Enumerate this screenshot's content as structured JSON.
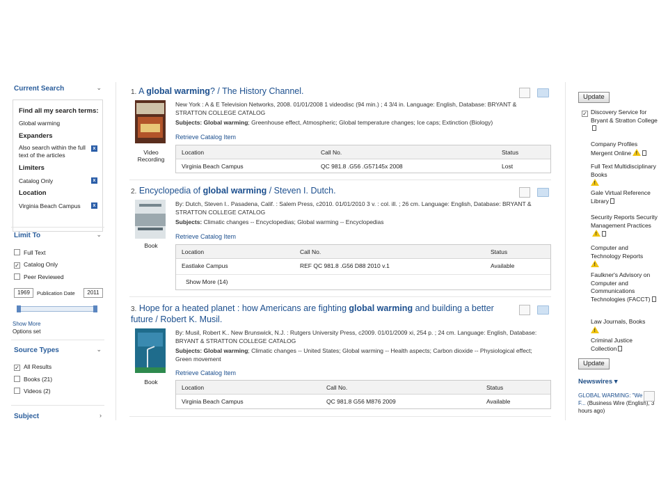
{
  "left": {
    "current_search": {
      "header": "Current Search",
      "find_all_label": "Find all my search terms:",
      "term": "Global warming",
      "expanders_label": "Expanders",
      "expander_item": "Also search within the full text of the articles",
      "limiters_label": "Limiters",
      "limiter_item": "Catalog Only",
      "location_label": "Location",
      "location_item": "Virginia Beach Campus"
    },
    "limit_to": {
      "header": "Limit To",
      "options": [
        {
          "label": "Full Text",
          "checked": false
        },
        {
          "label": "Catalog Only",
          "checked": true
        },
        {
          "label": "Peer Reviewed",
          "checked": false
        }
      ],
      "date_from": "1969",
      "date_label": "Publication Date",
      "date_to": "2011",
      "show_more": "Show More",
      "options_set": "Options set"
    },
    "source_types": {
      "header": "Source Types",
      "options": [
        {
          "label": "All Results",
          "checked": true
        },
        {
          "label": "Books (21)",
          "checked": false
        },
        {
          "label": "Videos (2)",
          "checked": false
        }
      ]
    },
    "subject_header": "Subject"
  },
  "results": [
    {
      "num": "1.",
      "title_pre": "A ",
      "title_bold": "global warming",
      "title_post": "? / The History Channel.",
      "title_line2": "",
      "type": "Video Recording",
      "meta": "New York : A & E Television Networks, 2008. 01/01/2008 1 videodisc (94 min.) ; 4 3/4 in. Language: English, Database: BRYANT & STRATTON COLLEGE CATALOG",
      "subjects_label": "Subjects:",
      "subjects_b1": "Global warming",
      "subjects_rest": "; Greenhouse effect, Atmospheric; Global temperature changes; Ice caps; Extinction (Biology)",
      "retrieve": "Retrieve Catalog Item",
      "holdings_headers": [
        "Location",
        "Call No.",
        "Status"
      ],
      "holdings": [
        "Virginia Beach Campus",
        "QC 981.8 .G56 .G57145x 2008",
        "Lost"
      ],
      "show_more": ""
    },
    {
      "num": "2.",
      "title_pre": "Encyclopedia of ",
      "title_bold": "global warming",
      "title_post": " / Steven I. Dutch.",
      "title_line2": "",
      "type": "Book",
      "meta": "By: Dutch, Steven I.. Pasadena, Calif. : Salem Press, c2010. 01/01/2010 3 v. : col. ill. ; 26 cm. Language: English, Database: BRYANT & STRATTON COLLEGE CATALOG",
      "subjects_label": "Subjects:",
      "subjects_b1": "",
      "subjects_rest": "Climatic changes -- Encyclopedias; Global warming -- Encyclopedias",
      "retrieve": "Retrieve Catalog Item",
      "holdings_headers": [
        "Location",
        "Call No.",
        "Status"
      ],
      "holdings": [
        "Eastlake Campus",
        "REF QC 981.8 .G56 D88 2010 v.1",
        "Available"
      ],
      "show_more": "Show More (14)"
    },
    {
      "num": "3.",
      "title_pre": "Hope for a heated planet : how Americans are fighting ",
      "title_bold": "global warming",
      "title_post": " and building a better",
      "title_line2": "future / Robert K. Musil.",
      "type": "Book",
      "meta": "By: Musil, Robert K.. New Brunswick, N.J. : Rutgers University Press, c2009. 01/01/2009 xi, 254 p. ; 24 cm. Language: English, Database: BRYANT & STRATTON COLLEGE CATALOG",
      "subjects_label": "Subjects:",
      "subjects_b1": "Global warming",
      "subjects_rest": "; Climatic changes -- United States; Global warming -- Health aspects; Carbon dioxide -- Physiological effect; Green movement",
      "retrieve": "Retrieve Catalog Item",
      "holdings_headers": [
        "Location",
        "Call No.",
        "Status"
      ],
      "holdings": [
        "Virginia Beach Campus",
        "QC 981.8 G56 M876 2009",
        "Available"
      ],
      "show_more": ""
    }
  ],
  "right": {
    "update_label": "Update",
    "discovery_label": "Discovery Service for Bryant & Stratton College",
    "databases": [
      "Company Profiles Mergent Online",
      "Full Text Multidisciplinary Books",
      "Gale Virtual Reference Library",
      "Security Reports Security Management Practices",
      "Computer and Technology Reports",
      "Faulkner's Advisory on Computer and Communications Technologies (FACCT)",
      "Law Journals, Books",
      "Criminal Justice Collection"
    ],
    "update_label2": "Update",
    "newswires_label": "Newswires",
    "news_title": "GLOBAL WARMING: \"We Can F...",
    "news_source": "(Business Wire (English), 3 hours ago)"
  },
  "colors": {
    "link": "#1c4f8e",
    "header": "#2a5d9b",
    "warning": "#f1c40f"
  }
}
